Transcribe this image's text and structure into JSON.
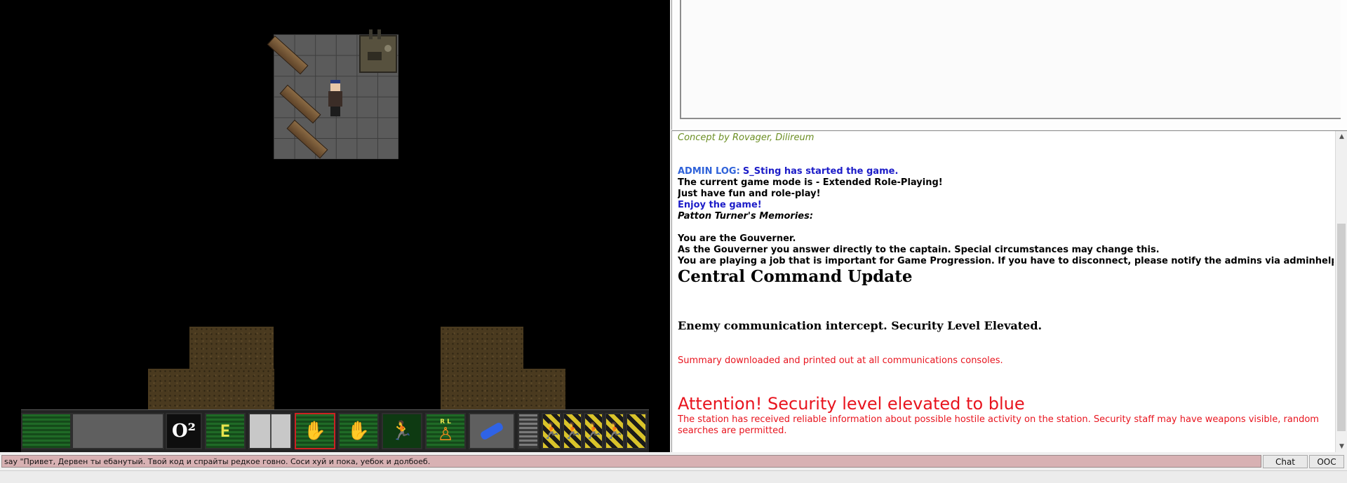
{
  "chat": {
    "lines": [
      {
        "text": "Concept by Rovager, Dilireum"
      },
      {
        "label": "ADMIN LOG:",
        "text": "S_Sting has started the game."
      },
      {
        "text": "The current game mode is - Extended Role-Playing!"
      },
      {
        "text": "Just have fun and role-play!"
      },
      {
        "text": "Enjoy the game!"
      },
      {
        "text": "Patton Turner's Memories:"
      },
      {
        "text": "You are the Gouverner."
      },
      {
        "text": "As the Gouverner you answer directly to the captain. Special circumstances may change this."
      },
      {
        "text": "You are playing a job that is important for Game Progression. If you have to disconnect, please notify the admins via adminhelp."
      },
      {
        "text": "Central Command Update"
      },
      {
        "text": "Enemy communication intercept.  Security Level Elevated."
      },
      {
        "text": "Summary downloaded and printed out at all communications consoles."
      },
      {
        "text": "Attention! Security level elevated to blue"
      },
      {
        "text": "The station has received reliable information about possible hostile activity on the station. Security staff may have weapons visible, random searches are permitted."
      }
    ]
  },
  "input": {
    "value": "say \"Привет, Дервен ты ебанутый. Твой код и спрайты редкое говно. Соси хуй и пока, уебок и долбоеб."
  },
  "buttons": {
    "chat": "Chat",
    "ooc": "OOC"
  },
  "hud": {
    "oxygen_label": "O²",
    "e_label": "E",
    "rl_label": "R L"
  },
  "colors": {
    "concept": "#6b8e23",
    "admin_blue": "#1c1cc8",
    "alert_red": "#e8141e",
    "input_bg": "#d8b1b3"
  }
}
